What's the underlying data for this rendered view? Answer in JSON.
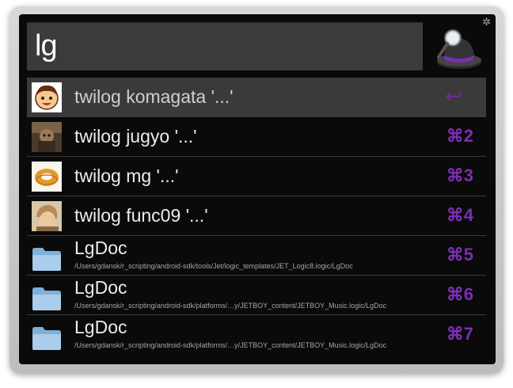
{
  "query": "lg",
  "results": [
    {
      "title": "twilog komagata '...'",
      "subtitle": "",
      "shortcut": "↩",
      "icon": "avatar-komagata-icon"
    },
    {
      "title": "twilog jugyo '...'",
      "subtitle": "",
      "shortcut": "⌘2",
      "icon": "avatar-jugyo-icon"
    },
    {
      "title": "twilog mg '...'",
      "subtitle": "",
      "shortcut": "⌘3",
      "icon": "avatar-mg-icon"
    },
    {
      "title": "twilog func09 '...'",
      "subtitle": "",
      "shortcut": "⌘4",
      "icon": "avatar-func09-icon"
    },
    {
      "title": "LgDoc",
      "subtitle": "/Users/gdansk/r_scripting/android-sdk/tools/Jet/logic_templates/JET_Logic8.logic/LgDoc",
      "shortcut": "⌘5",
      "icon": "folder-icon"
    },
    {
      "title": "LgDoc",
      "subtitle": "/Users/gdansk/r_scripting/android-sdk/platforms/…y/JETBOY_content/JETBOY_Music.logic/LgDoc",
      "shortcut": "⌘6",
      "icon": "folder-icon"
    },
    {
      "title": "LgDoc",
      "subtitle": "/Users/gdansk/r_scripting/android-sdk/platforms/…y/JETBOY_content/JETBOY_Music.logic/LgDoc",
      "shortcut": "⌘7",
      "icon": "folder-icon"
    }
  ],
  "colors": {
    "accent": "#7a2fb1",
    "background": "#0a0a0a",
    "selected_row": "#3a3a3a"
  }
}
